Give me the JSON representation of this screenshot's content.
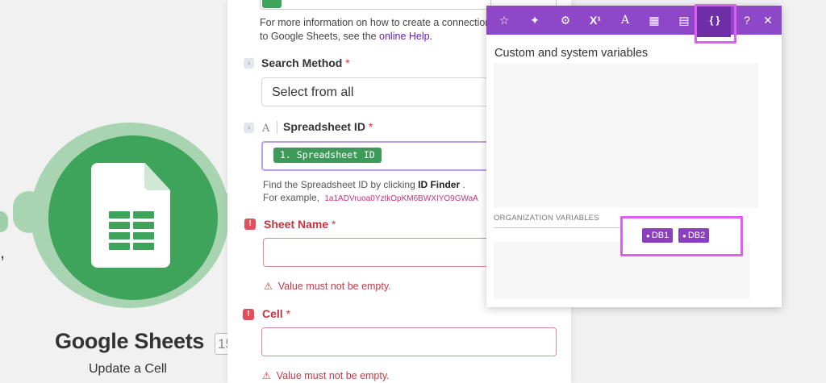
{
  "module": {
    "title": "Google Sheets",
    "badge": "15",
    "subtitle": "Update a Cell",
    "brand_color": "#3fa45b",
    "icon": "google-sheets-icon"
  },
  "panel": {
    "info_text": "For more information on how to create a connection to Google Sheets, see the",
    "info_link": "online Help",
    "info_end": ".",
    "search_method": {
      "label": "Search Method",
      "required_mark": "*",
      "value": "Select from all"
    },
    "spreadsheet_id": {
      "type_icon": "A",
      "label": "Spreadsheet ID",
      "required_mark": "*",
      "mapped_value": "1. Spreadsheet ID",
      "hint_prefix": "Find the Spreadsheet ID by clicking",
      "hint_bold": "ID Finder",
      "hint_suffix": ".",
      "example_prefix": "For example,",
      "example_value": "1a1ADVruoa0YztkOpKM6BWXIYO9GWaA"
    },
    "sheet_name": {
      "label": "Sheet Name",
      "required_mark": "*",
      "error": "Value must not be empty."
    },
    "cell": {
      "label": "Cell",
      "required_mark": "*",
      "error": "Value must not be empty."
    },
    "error_marker": "!",
    "error_triangle": "⚠"
  },
  "popup": {
    "toolbar": {
      "star": "☆",
      "sparkle": "✦",
      "gear": "⚙",
      "superscript": "X¹",
      "text": "A",
      "calendar": "▦",
      "table": "▤",
      "variables": "{ }",
      "help": "?",
      "close": "✕"
    },
    "heading": "Custom and system variables",
    "org_label": "ORGANIZATION VARIABLES",
    "variables": [
      "DB1",
      "DB2"
    ],
    "accent_color": "#8e48c7",
    "highlight_color": "#e15ef3"
  }
}
